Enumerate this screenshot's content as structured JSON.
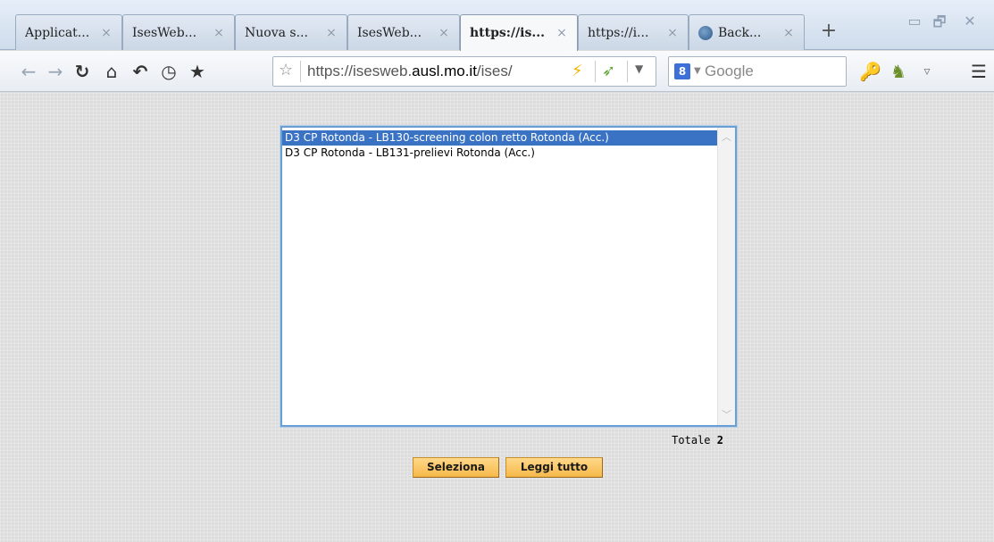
{
  "browser": {
    "tabs": [
      {
        "title": "Applicat...",
        "close": "×",
        "active": false
      },
      {
        "title": "IsesWeb...",
        "close": "×",
        "active": false
      },
      {
        "title": "Nuova s...",
        "close": "×",
        "active": false
      },
      {
        "title": "IsesWeb...",
        "close": "×",
        "active": false
      },
      {
        "title": "https://is...",
        "close": "×",
        "active": true
      },
      {
        "title": "https://i...",
        "close": "×",
        "active": false
      },
      {
        "title": "Back...",
        "close": "×",
        "active": false,
        "icon": "globe-icon"
      }
    ],
    "new_tab": "+",
    "window_controls": {
      "minimize": "▭",
      "restore": "🗗",
      "close": "✕"
    },
    "toolbar": {
      "back": "←",
      "forward": "→",
      "reload": "↻",
      "home": "⌂",
      "undo": "↶",
      "history": "◷",
      "bookmark": "★"
    },
    "url": {
      "scheme": "https://isesweb.",
      "host": "ausl.mo.it",
      "path": "/ises/",
      "star": "☆"
    },
    "search": {
      "engine_letter": "8",
      "placeholder": "Google"
    },
    "right_icons": {
      "key": "🔑",
      "puzzle": "♞",
      "menu_arrow": "▿",
      "menu": "☰"
    }
  },
  "page": {
    "list_items": [
      {
        "text": "D3 CP Rotonda - LB130-screening colon retto Rotonda (Acc.)",
        "selected": true
      },
      {
        "text": "D3 CP Rotonda - LB131-prelievi Rotonda (Acc.)",
        "selected": false
      }
    ],
    "totale_label": "Totale",
    "totale_value": "2",
    "buttons": {
      "select": "Seleziona",
      "read_all": "Leggi tutto"
    }
  }
}
